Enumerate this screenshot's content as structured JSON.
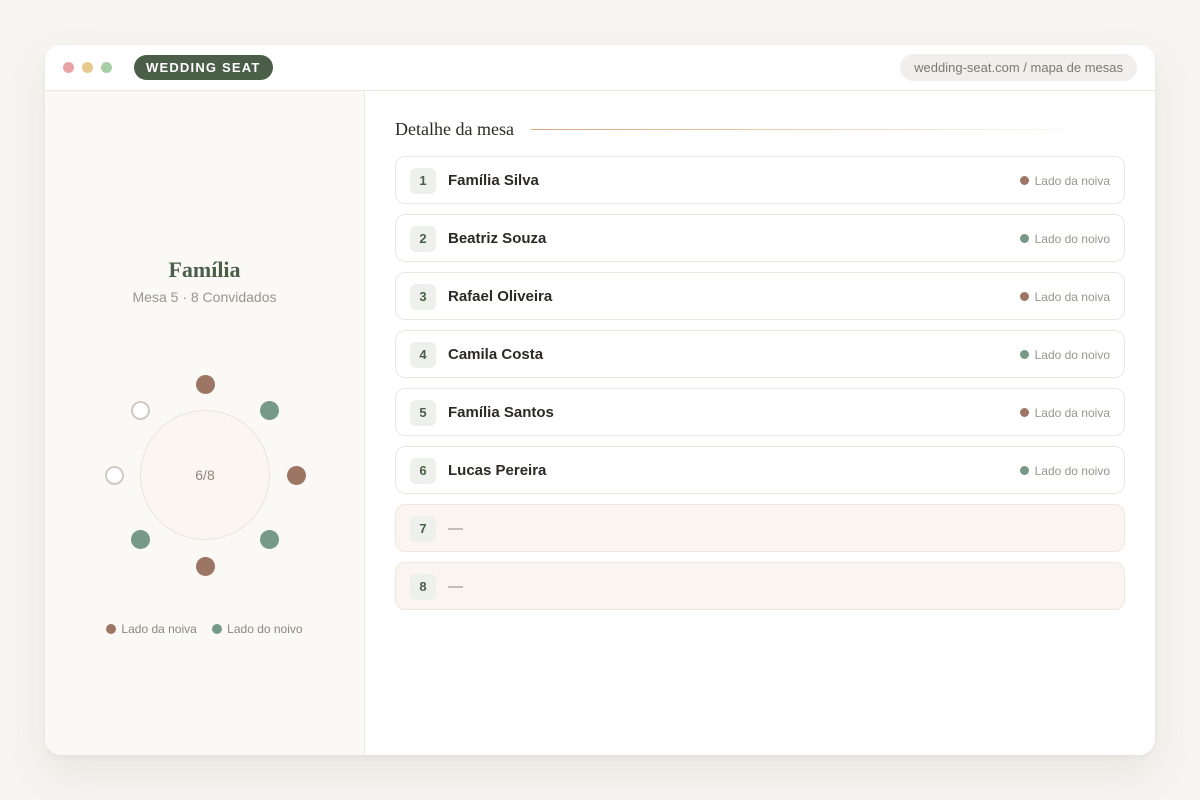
{
  "window": {
    "brand": "WEDDING SEAT",
    "url": "wedding-seat.com / mapa de mesas",
    "traffic_lights": {
      "red": "#e8a3a6",
      "yellow": "#e9c98e",
      "green": "#a7cfa5"
    }
  },
  "colors": {
    "bride": "#9c7565",
    "groom": "#779a88",
    "accent": "#4a5e48"
  },
  "table": {
    "name": "Família",
    "subtitle": "Mesa 5 · 8 Convidados",
    "occupancy": "6/8",
    "seats": [
      {
        "side": "bride"
      },
      {
        "side": "groom"
      },
      {
        "side": "bride"
      },
      {
        "side": "groom"
      },
      {
        "side": "bride"
      },
      {
        "side": "groom"
      },
      {
        "side": "empty"
      },
      {
        "side": "empty"
      }
    ]
  },
  "legend": {
    "bride": "Lado da noiva",
    "groom": "Lado do noivo"
  },
  "detail": {
    "title": "Detalhe da mesa",
    "guests": [
      {
        "number": "1",
        "name": "Família Silva",
        "side": "bride",
        "side_label": "Lado da noiva"
      },
      {
        "number": "2",
        "name": "Beatriz Souza",
        "side": "groom",
        "side_label": "Lado do noivo"
      },
      {
        "number": "3",
        "name": "Rafael Oliveira",
        "side": "bride",
        "side_label": "Lado da noiva"
      },
      {
        "number": "4",
        "name": "Camila Costa",
        "side": "groom",
        "side_label": "Lado do noivo"
      },
      {
        "number": "5",
        "name": "Família Santos",
        "side": "bride",
        "side_label": "Lado da noiva"
      },
      {
        "number": "6",
        "name": "Lucas Pereira",
        "side": "groom",
        "side_label": "Lado do noivo"
      },
      {
        "number": "7",
        "name": "—",
        "side": "empty",
        "side_label": ""
      },
      {
        "number": "8",
        "name": "—",
        "side": "empty",
        "side_label": ""
      }
    ]
  }
}
